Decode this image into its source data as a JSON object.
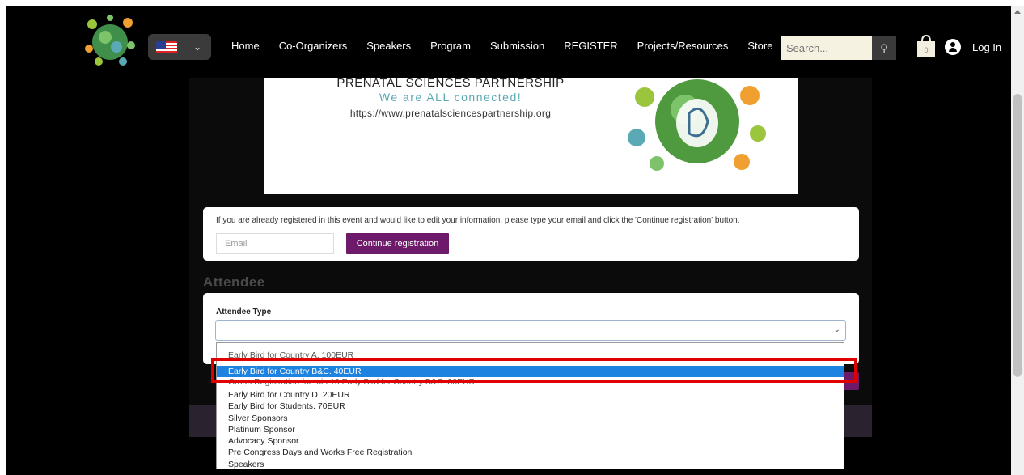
{
  "header": {
    "nav": [
      "Home",
      "Co-Organizers",
      "Speakers",
      "Program",
      "Submission",
      "REGISTER",
      "Projects/Resources",
      "Store"
    ],
    "search_placeholder": "Search...",
    "login": "Log In",
    "cart_count": "0"
  },
  "banner": {
    "line1": "PRENATAL SCIENCES PARTNERSHIP",
    "line2": "We are ALL connected!",
    "line3": "https://www.prenatalsciencespartnership.org"
  },
  "notice": {
    "message": "If you are already registered in this event and would like to edit your information, please type your email and click the 'Continue registration' button.",
    "email_placeholder": "Email",
    "continue_label": "Continue registration"
  },
  "attendee": {
    "section_title": "Attendee",
    "type_label": "Attendee Type",
    "selected_value": ""
  },
  "dropdown": {
    "options": [
      "Early Bird for Country A. 100EUR",
      "Early Bird for Country B&C. 40EUR",
      "Group Registration for min 10 Early Bird for Country B&C. 30EUR",
      "Early Bird for Country D. 20EUR",
      "Early Bird for Students. 70EUR",
      "Silver Sponsors",
      "Platinum Sponsor",
      "Advocacy Sponsor",
      "Pre Congress Days and Works Free Registration",
      "Speakers"
    ],
    "highlighted_index": 1
  },
  "colors": {
    "accent_purple": "#6d1a6a",
    "highlight_red": "#e00000",
    "selection_blue": "#1e82e0"
  }
}
